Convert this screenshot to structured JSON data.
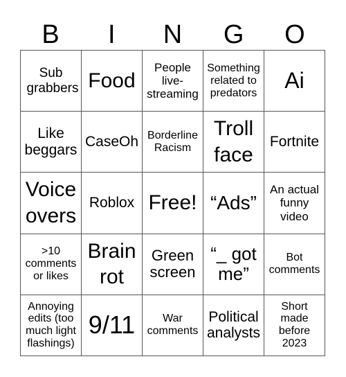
{
  "header": {
    "letters": [
      "B",
      "I",
      "N",
      "G",
      "O"
    ]
  },
  "grid": {
    "rows": [
      [
        "Sub grabbers",
        "Food",
        "People live-streaming",
        "Something related to predators",
        "Ai"
      ],
      [
        "Like beggars",
        "CaseOh",
        "Borderline Racism",
        "Troll face",
        "Fortnite"
      ],
      [
        "Voice overs",
        "Roblox",
        "Free!",
        "“Ads”",
        "An actual funny video"
      ],
      [
        ">10 comments or likes",
        "Brain rot",
        "Green screen",
        "“_ got me”",
        "Bot comments"
      ],
      [
        "Annoying edits (too much light flashings)",
        "9/11",
        "War comments",
        "Political analysts",
        "Short made before 2023"
      ]
    ]
  }
}
